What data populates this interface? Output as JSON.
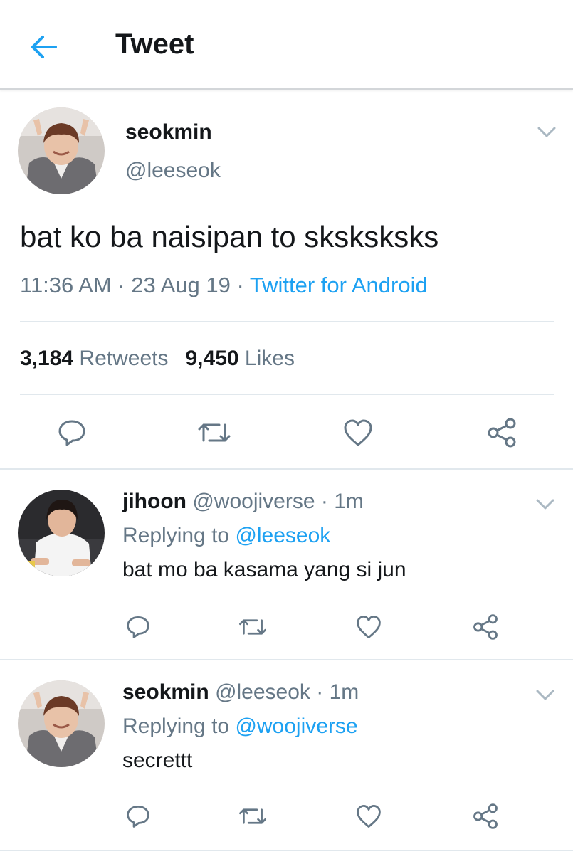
{
  "header": {
    "title": "Tweet",
    "back_icon": "arrow-left-icon",
    "accent_color": "#1da1f2"
  },
  "main_tweet": {
    "name": "seokmin",
    "handle": "@leeseok",
    "text": "bat ko ba naisipan to sksksksks",
    "time": "11:36 AM",
    "dot1": " · ",
    "date": "23 Aug 19",
    "dot2": " · ",
    "source": "Twitter for Android",
    "retweets_count": "3,184",
    "retweets_label": "Retweets",
    "likes_count": "9,450",
    "likes_label": "Likes"
  },
  "replies": [
    {
      "name": "jihoon",
      "handle": "@woojiverse",
      "time_sep": " · ",
      "time": "1m",
      "replying_prefix": "Replying to ",
      "replying_to": "@leeseok",
      "text": "bat mo ba kasama yang si jun"
    },
    {
      "name": "seokmin",
      "handle": "@leeseok",
      "time_sep": " · ",
      "time": "1m",
      "replying_prefix": "Replying to ",
      "replying_to": "@woojiverse",
      "text": "secrettt"
    }
  ]
}
